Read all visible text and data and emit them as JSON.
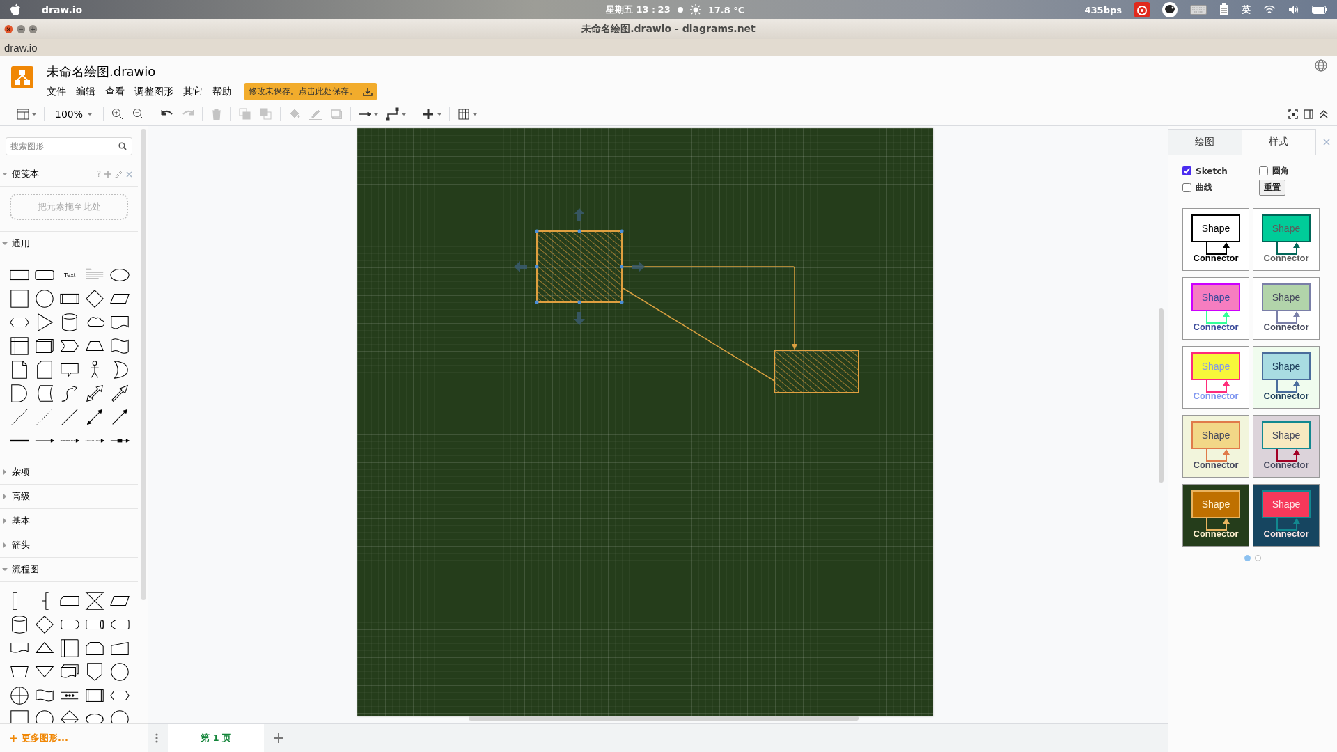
{
  "os_bar": {
    "app": "draw.io",
    "clock": "星期五 13：23",
    "weather": "17.8 °C",
    "net_speed": "435bps",
    "input_method": "英"
  },
  "window": {
    "title": "未命名绘图.drawio - diagrams.net",
    "app_label": "draw.io"
  },
  "header": {
    "file_name": "未命名绘图.drawio",
    "menu": [
      "文件",
      "编辑",
      "查看",
      "调整图形",
      "其它",
      "帮助"
    ],
    "save_notice": "修改未保存。点击此处保存。"
  },
  "toolbar": {
    "zoom": "100%",
    "tools": [
      {
        "kind": "panel",
        "disabled": false
      },
      {
        "kind": "zoom_in",
        "disabled": false
      },
      {
        "kind": "zoom_out",
        "disabled": false
      },
      {
        "kind": "undo",
        "disabled": false
      },
      {
        "kind": "redo",
        "disabled": true
      },
      {
        "kind": "delete",
        "disabled": true
      },
      {
        "kind": "to_front",
        "disabled": true
      },
      {
        "kind": "to_back",
        "disabled": true
      },
      {
        "kind": "fill",
        "disabled": true
      },
      {
        "kind": "line_color",
        "disabled": true
      },
      {
        "kind": "shadow",
        "disabled": true
      },
      {
        "kind": "connection",
        "disabled": false
      },
      {
        "kind": "waypoint",
        "disabled": false
      },
      {
        "kind": "insert",
        "disabled": false
      },
      {
        "kind": "table",
        "disabled": false
      }
    ]
  },
  "sidebar": {
    "search": {
      "placeholder": "搜索图形"
    },
    "sections": [
      {
        "kind": "scratchpad",
        "title": "便笺本",
        "expanded": true,
        "help": "?",
        "drop_hint": "把元素拖至此处"
      },
      {
        "kind": "general",
        "title": "通用",
        "expanded": true,
        "text_shape": "Text"
      },
      {
        "kind": "library",
        "title": "杂项",
        "expanded": false
      },
      {
        "kind": "library",
        "title": "高级",
        "expanded": false
      },
      {
        "kind": "library",
        "title": "基本",
        "expanded": false
      },
      {
        "kind": "library",
        "title": "箭头",
        "expanded": false
      },
      {
        "kind": "flowchart",
        "title": "流程图",
        "expanded": true
      }
    ],
    "more_shapes": "更多图形..."
  },
  "diagram": {
    "shapes": [
      {
        "selected": true
      },
      {
        "selected": false
      }
    ]
  },
  "page_tabs": [
    {
      "label": "第 1 页",
      "selected": true
    }
  ],
  "format_panel": {
    "tabs": [
      {
        "label": "绘图",
        "selected": false
      },
      {
        "label": "样式",
        "selected": true
      }
    ],
    "options": [
      {
        "label": "Sketch",
        "checked": true
      },
      {
        "label": "圆角",
        "checked": false
      },
      {
        "label": "曲线",
        "checked": false
      }
    ],
    "reset_button": "重置",
    "swatches": [
      {
        "color": "#ffffff",
        "font": {
          "color": "#000000"
        },
        "shape": {
          "label": "Shape",
          "color": "#ffffff",
          "outline": {
            "color": "#000000"
          }
        },
        "connector": {
          "label": "Connector",
          "color": "#000000"
        }
      },
      {
        "color": "#ffffff",
        "font": {
          "color": "#5c5c5c"
        },
        "shape": {
          "label": "Shape",
          "color": "#00cc99",
          "outline": {
            "color": "#006658"
          }
        },
        "connector": {
          "label": "Connector",
          "color": "#006658"
        }
      },
      {
        "color": "#ffffff",
        "font": {
          "color": "#3a4a9a"
        },
        "shape": {
          "label": "Shape",
          "color": "#f67dc0",
          "outline": {
            "color": "#cc00ff"
          }
        },
        "connector": {
          "label": "Connector",
          "color": "#33ff99"
        }
      },
      {
        "color": "#ffffff",
        "font": {
          "color": "#46495d"
        },
        "shape": {
          "label": "Shape",
          "color": "#b2d4aa",
          "outline": {
            "color": "#7a7fa8"
          }
        },
        "connector": {
          "label": "Connector",
          "color": "#7a7fa8"
        }
      },
      {
        "color": "#ffffff",
        "font": {
          "color": "#7f96f0"
        },
        "shape": {
          "label": "Shape",
          "color": "#f7f73a",
          "outline": {
            "color": "#ff2c7a"
          }
        },
        "connector": {
          "label": "Connector",
          "color": "#ff2c7a"
        }
      },
      {
        "color": "#f0fcee",
        "font": {
          "color": "#1c3c5a"
        },
        "shape": {
          "label": "Shape",
          "color": "#a8dce2",
          "outline": {
            "color": "#4a6d9c"
          }
        },
        "connector": {
          "label": "Connector",
          "color": "#4a6d9c"
        }
      },
      {
        "color": "#f2f5dc",
        "font": {
          "color": "#46495d"
        },
        "shape": {
          "label": "Shape",
          "color": "#f2d787",
          "outline": {
            "color": "#e07a4a"
          }
        },
        "connector": {
          "label": "Connector",
          "color": "#e07a4a"
        }
      },
      {
        "color": "#dcd3da",
        "font": {
          "color": "#46495d"
        },
        "shape": {
          "label": "Shape",
          "color": "#f7e9c0",
          "outline": {
            "color": "#12888f"
          }
        },
        "connector": {
          "label": "Connector",
          "color": "#a20025"
        }
      },
      {
        "color": "#253d1b",
        "font": {
          "color": "#fff1d0"
        },
        "shape": {
          "label": "Shape",
          "color": "#bf7000",
          "outline": {
            "color": "#e9b35f"
          }
        },
        "connector": {
          "label": "Connector",
          "color": "#e9b35f"
        }
      },
      {
        "color": "#164560",
        "font": {
          "color": "#fce6e6"
        },
        "shape": {
          "label": "Shape",
          "color": "#f6385a",
          "outline": {
            "color": "#12888f"
          }
        },
        "connector": {
          "label": "Connector",
          "color": "#12888f"
        }
      }
    ],
    "pages": [
      {
        "selected": true
      },
      {
        "selected": false
      }
    ]
  }
}
